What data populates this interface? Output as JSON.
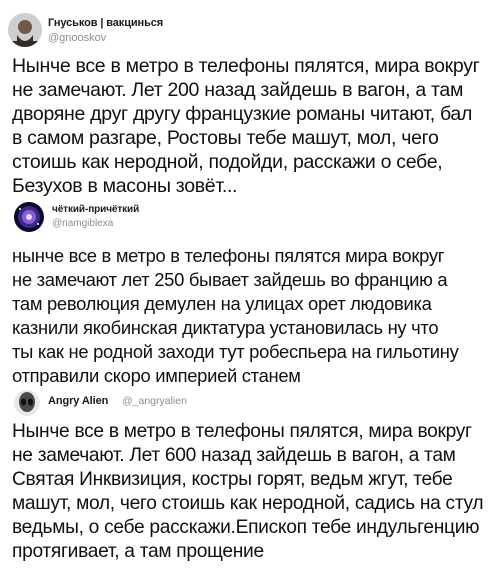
{
  "tweets": [
    {
      "name": "Гнуськов | вакцинься",
      "handle": "@gnooskov",
      "avatar": "bearded-man-avatar",
      "lines": [
        "Нынче все в метро в телефоны пялятся, мира вокруг",
        "не замечают. Лет 200 назад зайдешь в вагон, а там",
        "дворяне друг другу французкие романы читают, бал",
        "в самом разгаре, Ростовы тебе машут, мол, чего",
        "стоишь как неродной, подойди, расскажи о себе,",
        "Безухов в масоны зовёт..."
      ]
    },
    {
      "name": "чёткий-причёткий",
      "handle": "@namgiblexa",
      "avatar": "galaxy-avatar",
      "lines": [
        "нынче все в метро в телефоны пялятся мира вокруг",
        "не замечают лет 250 бывает зайдешь во францию а",
        "там революция демулен на улицах орет людовика",
        "казнили якобинская диктатура установилась ну что",
        "ты как не родной заходи тут робеспьера на гильотину",
        "отправили скоро империей станем"
      ]
    },
    {
      "name": "Angry Alien",
      "handle": "@_angryalien",
      "avatar": "alien-avatar",
      "lines": [
        "Нынче все в метро в телефоны пялятся, мира вокруг",
        "не замечают. Лет 600 назад зайдешь в вагон, а там",
        "Святая Инквизиция, костры горят, ведьм жгут, тебе",
        "машут, мол, чего стоишь как неродной, садись на стул",
        "ведьмы, о себе расскажи.Епископ тебе индульгенцию",
        "протягивает, а там прощение"
      ]
    }
  ]
}
